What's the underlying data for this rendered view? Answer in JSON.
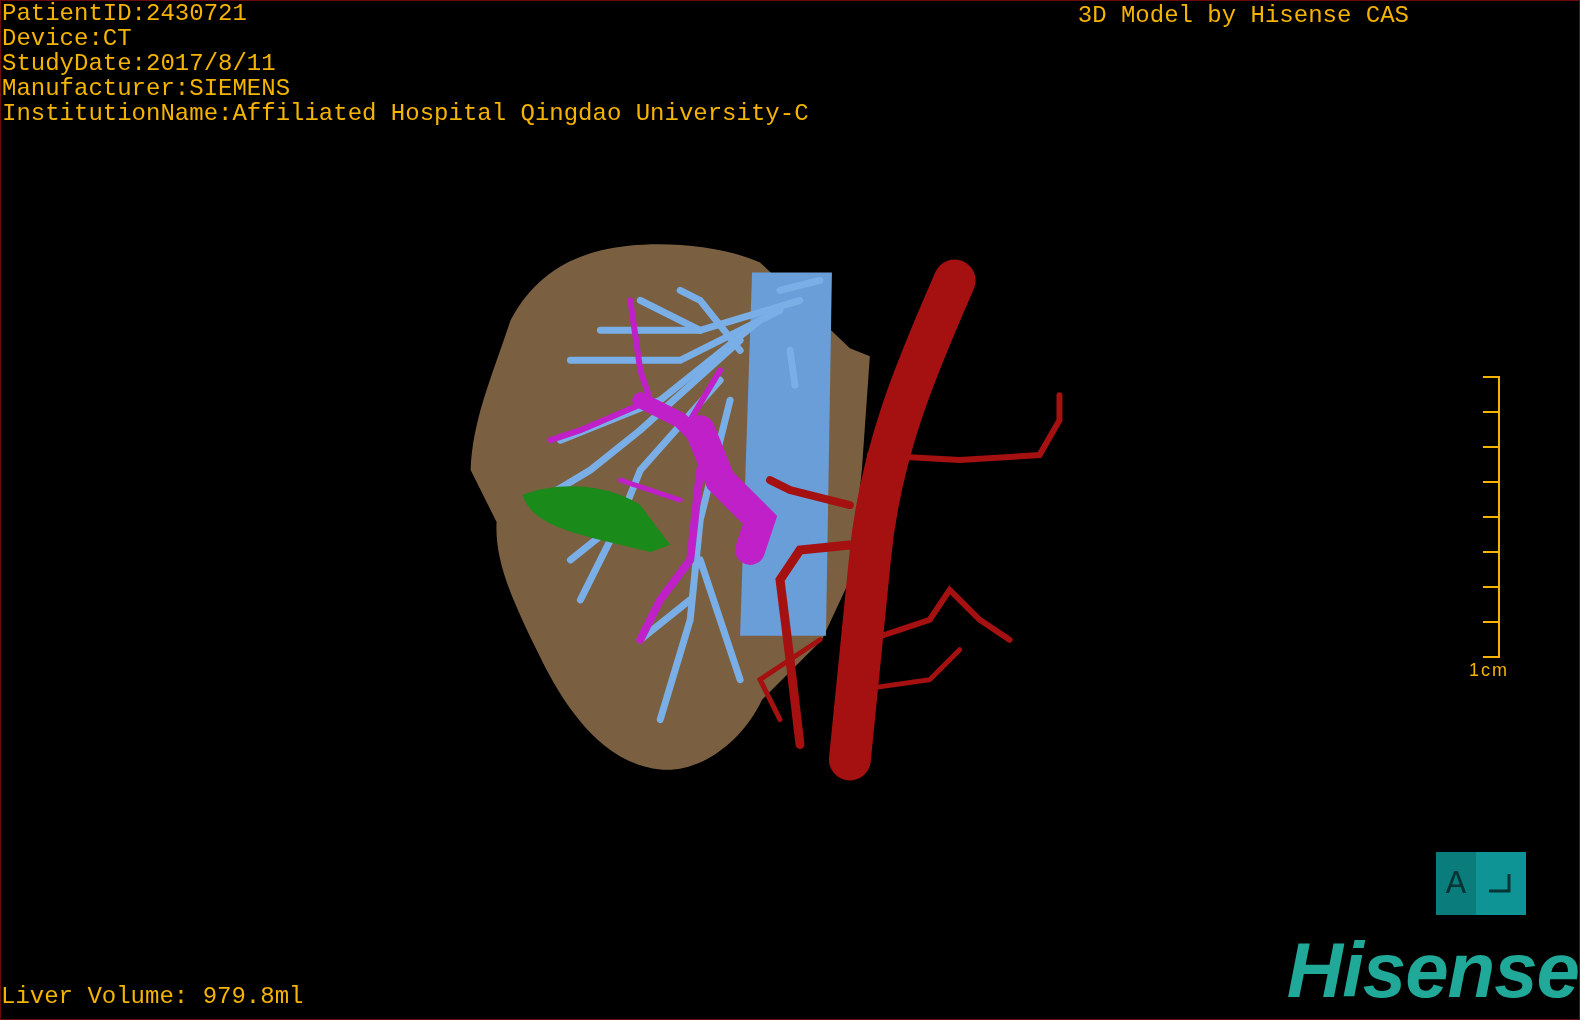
{
  "info_lines": [
    "PatientID:2430721",
    "Device:CT",
    "StudyDate:2017/8/11",
    "Manufacturer:SIEMENS",
    "InstitutionName:Affiliated Hospital Qingdao University-C"
  ],
  "title": "3D Model by Hisense CAS",
  "scale_bar": {
    "label": "1cm"
  },
  "orientation": {
    "label": "A"
  },
  "logo": "Hisense",
  "liver_volume": "Liver Volume: 979.8ml"
}
